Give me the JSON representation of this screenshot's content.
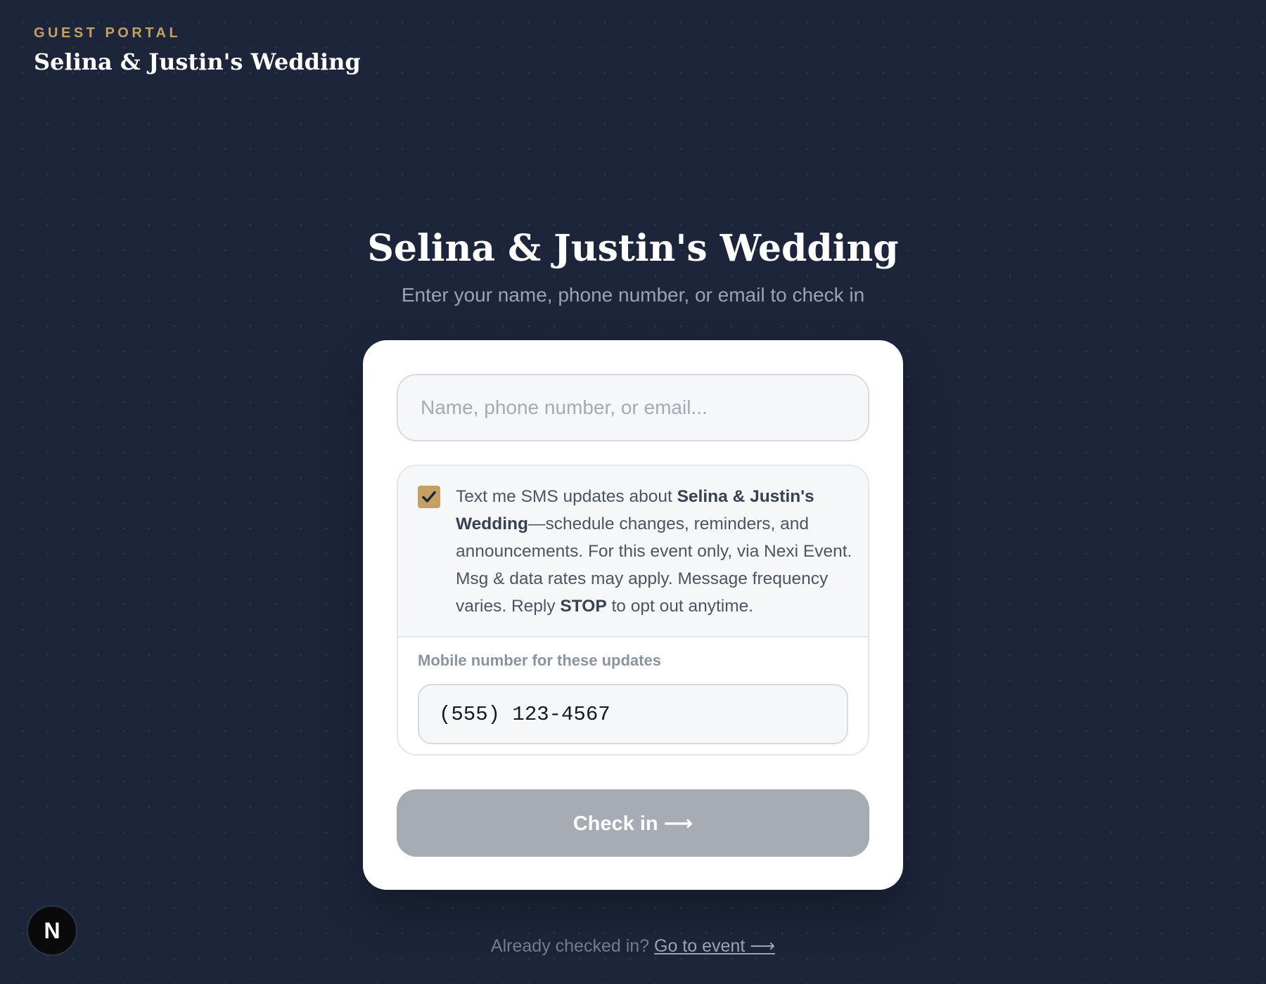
{
  "header": {
    "eyebrow": "GUEST PORTAL",
    "title": "Selina & Justin's Wedding"
  },
  "hero": {
    "title": "Selina & Justin's Wedding",
    "subtitle": "Enter your name, phone number, or email to check in"
  },
  "search": {
    "placeholder": "Name, phone number, or email...",
    "value": ""
  },
  "sms": {
    "checked": true,
    "text_part1": "Text me SMS updates about ",
    "event_name": "Selina & Justin's Wedding",
    "text_part2": "—schedule changes, reminders, and announcements. For this event only, via Nexi Event. Msg & data rates may apply. Message frequency varies. Reply ",
    "stop_keyword": "STOP",
    "text_part3": " to opt out anytime.",
    "mobile_label": "Mobile number for these updates",
    "mobile_value": "(555) 123-4567"
  },
  "button": {
    "label": "Check in ⟶"
  },
  "footer": {
    "prompt": "Already checked in? ",
    "link": "Go to event ⟶"
  },
  "fab": {
    "letter": "N"
  },
  "colors": {
    "background": "#1c253a",
    "accent_gold": "#c4a063",
    "button_disabled": "#a7abb3",
    "card": "#ffffff"
  },
  "icons": {
    "checkbox": "checkmark-icon",
    "fab": "nextjs-logo-icon"
  }
}
